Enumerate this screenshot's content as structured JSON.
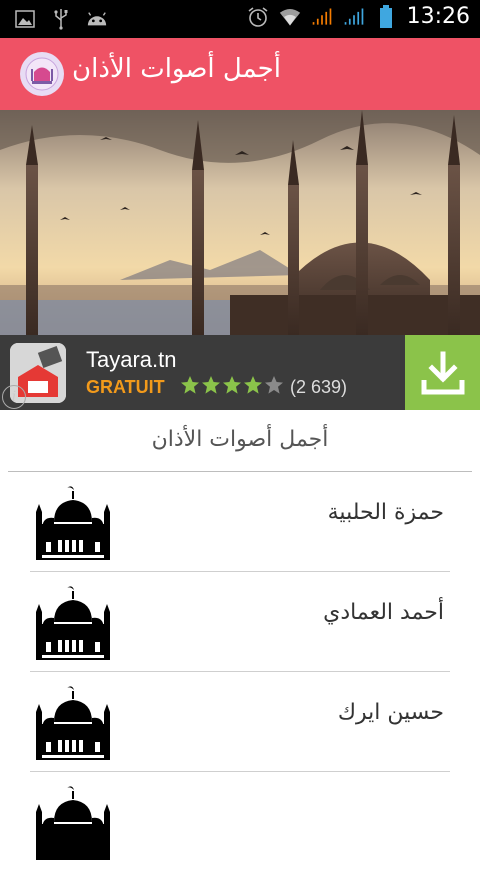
{
  "status_bar": {
    "time": "13:26",
    "left_icons": [
      "image-icon",
      "usb-icon",
      "android-icon"
    ],
    "right_icons": [
      "alarm-icon",
      "wifi-icon",
      "signal-orange-icon",
      "signal-green-icon",
      "battery-icon"
    ]
  },
  "app_bar": {
    "title": "أجمل أصوات الأذان",
    "color": "#ef5265"
  },
  "ad": {
    "app_name": "Tayara.tn",
    "price_label": "GRATUIT",
    "rating": 4,
    "rating_max": 5,
    "rating_count": "(2 639)",
    "accent": "#8bc34a"
  },
  "list": {
    "header": "أجمل أصوات الأذان",
    "items": [
      {
        "label": "حمزة الحلبية"
      },
      {
        "label": "أحمد العمادي"
      },
      {
        "label": "حسين ايرك"
      },
      {
        "label": ""
      }
    ]
  }
}
